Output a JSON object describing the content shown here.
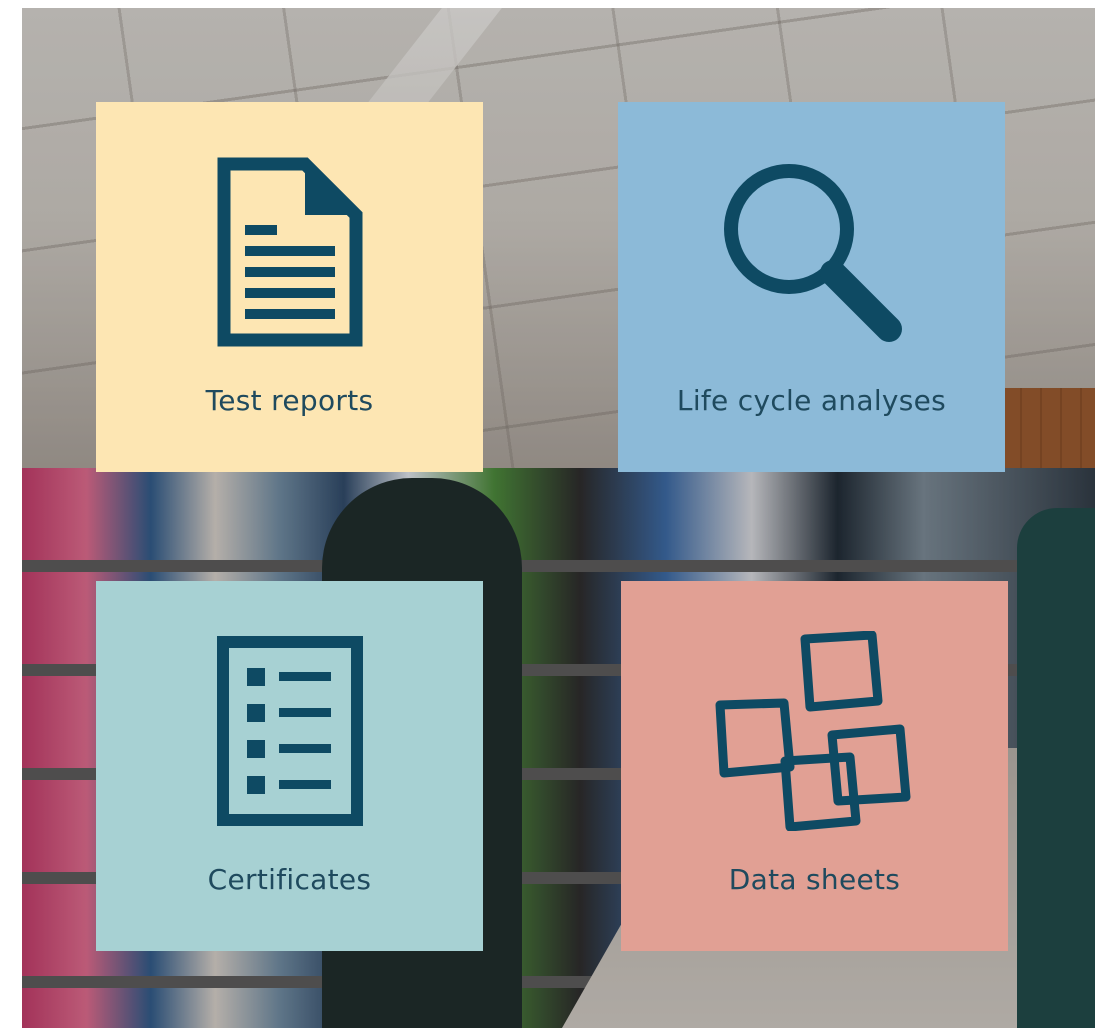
{
  "tiles": [
    {
      "label": "Test reports",
      "icon": "document-icon",
      "color": "#fde6b3"
    },
    {
      "label": "Life cycle analyses",
      "icon": "magnifier-icon",
      "color": "#8cbad8"
    },
    {
      "label": "Certificates",
      "icon": "checklist-icon",
      "color": "#a7d1d3"
    },
    {
      "label": "Data sheets",
      "icon": "stacked-sheets-icon",
      "color": "#e1a094"
    }
  ],
  "colors": {
    "icon": "#0e4a63",
    "label_text": "#1f4a5e"
  }
}
